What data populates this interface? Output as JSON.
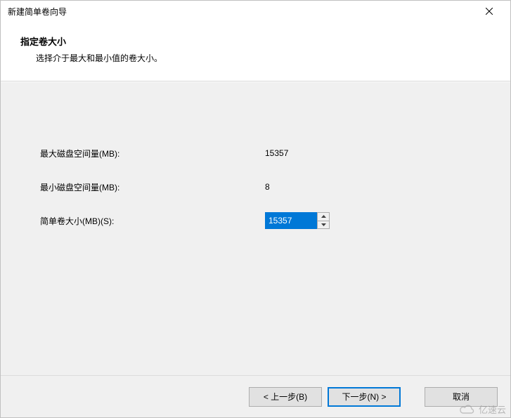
{
  "window": {
    "title": "新建简单卷向导"
  },
  "header": {
    "title": "指定卷大小",
    "subtitle": "选择介于最大和最小值的卷大小。"
  },
  "fields": {
    "max_label": "最大磁盘空间量(MB):",
    "max_value": "15357",
    "min_label": "最小磁盘空间量(MB):",
    "min_value": "8",
    "size_label": "简单卷大小(MB)(S):",
    "size_value": "15357"
  },
  "buttons": {
    "back": "< 上一步(B)",
    "next": "下一步(N) >",
    "cancel": "取消"
  },
  "watermark": {
    "text": "亿速云"
  }
}
